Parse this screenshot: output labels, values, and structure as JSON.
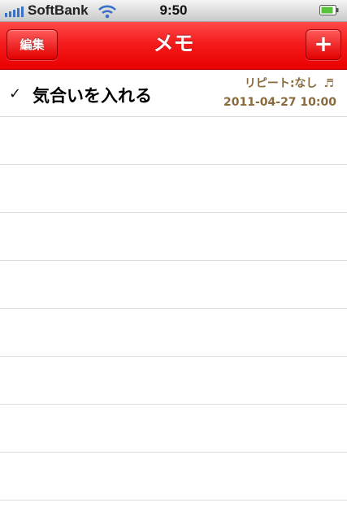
{
  "status_bar": {
    "carrier": "SoftBank",
    "time": "9:50",
    "signal_icon": "signal-bars-icon",
    "wifi_icon": "wifi-icon",
    "battery_icon": "battery-icon",
    "signal_color": "#3b72c8"
  },
  "nav": {
    "title": "メモ",
    "edit_label": "編集",
    "add_label": "+",
    "color": "#f41c1c"
  },
  "memos": [
    {
      "check": "✓",
      "title": "気合いを入れる",
      "repeat": "リピート:なし",
      "note_icon": "♬",
      "date": "2011-04-27 10:00",
      "meta_color": "#8a6a3c"
    }
  ]
}
